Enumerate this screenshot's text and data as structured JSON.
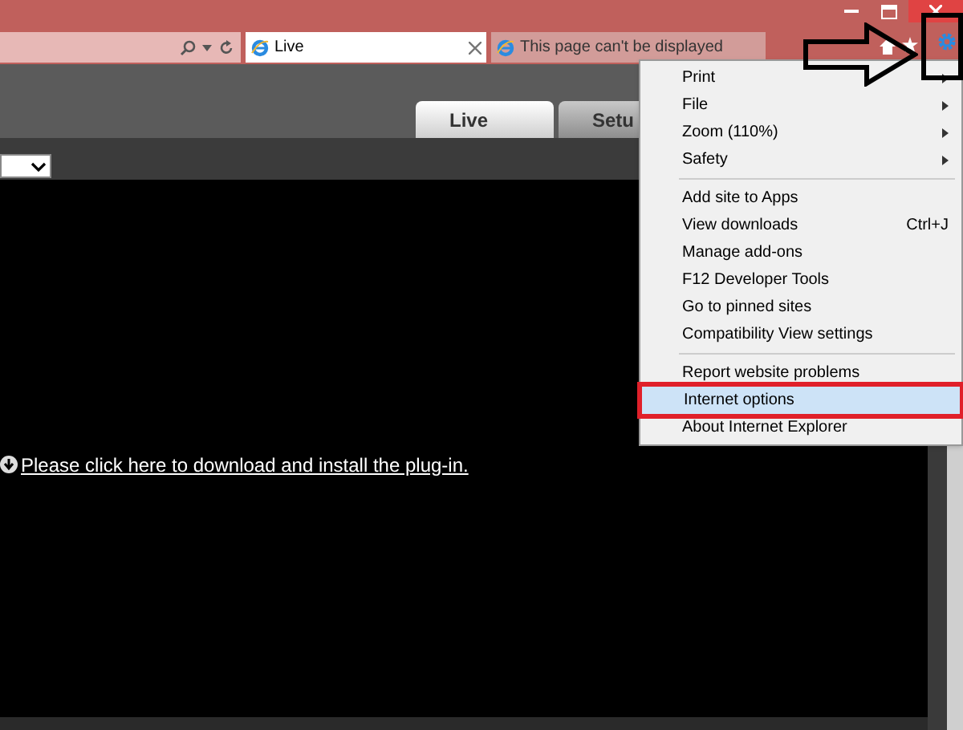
{
  "browser_tabs": [
    {
      "label": "Live",
      "selected": true
    },
    {
      "label": "This page can't be displayed",
      "selected": false
    }
  ],
  "page_tabs": [
    {
      "label": "Live",
      "selected": true
    },
    {
      "label": "Setu",
      "selected": false
    }
  ],
  "plugin_link": "Please click here to download and install the plug-in.",
  "tools_menu": {
    "groups": [
      [
        {
          "label": "Print",
          "submenu": true,
          "selected": false
        },
        {
          "label": "File",
          "submenu": true,
          "selected": false
        },
        {
          "label": "Zoom (110%)",
          "submenu": true,
          "selected": false
        },
        {
          "label": "Safety",
          "submenu": true,
          "selected": false
        }
      ],
      [
        {
          "label": "Add site to Apps",
          "submenu": false,
          "selected": false
        },
        {
          "label": "View downloads",
          "shortcut": "Ctrl+J",
          "submenu": false,
          "selected": false
        },
        {
          "label": "Manage add-ons",
          "submenu": false,
          "selected": false
        },
        {
          "label": "F12 Developer Tools",
          "submenu": false,
          "selected": false
        },
        {
          "label": "Go to pinned sites",
          "submenu": false,
          "selected": false
        },
        {
          "label": "Compatibility View settings",
          "submenu": false,
          "selected": false
        }
      ],
      [
        {
          "label": "Report website problems",
          "submenu": false,
          "selected": false
        },
        {
          "label": "Internet options",
          "submenu": false,
          "selected": true
        },
        {
          "label": "About Internet Explorer",
          "submenu": false,
          "selected": false
        }
      ]
    ]
  }
}
